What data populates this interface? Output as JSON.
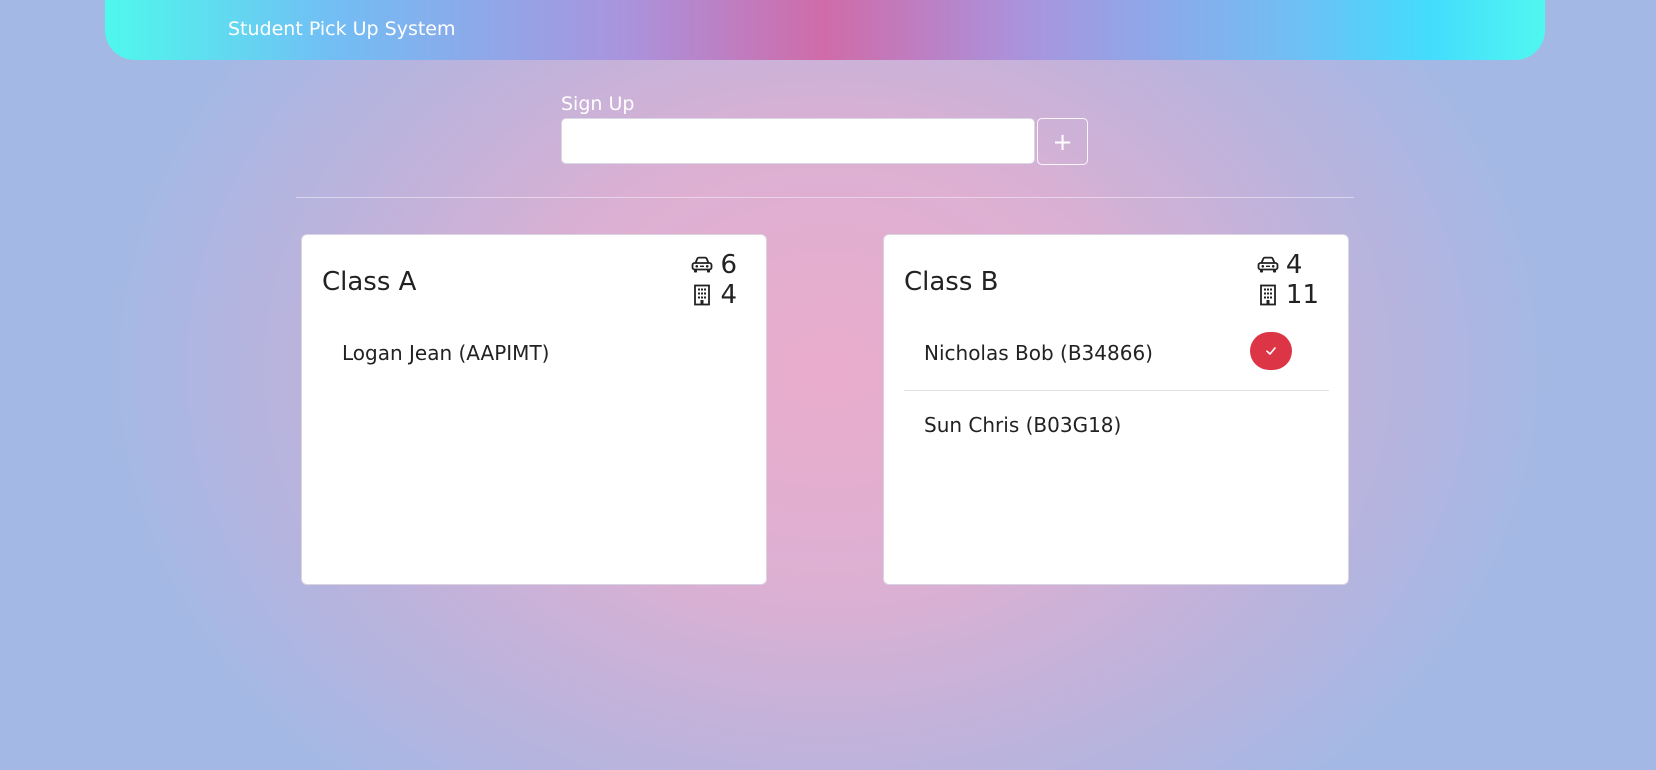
{
  "navbar": {
    "brand": "Student Pick Up System"
  },
  "signup": {
    "label": "Sign Up",
    "input_value": "",
    "add_button_label": "+"
  },
  "classes": [
    {
      "title": "Class A",
      "car_count": "6",
      "building_count": "4",
      "students": [
        {
          "name": "Logan Jean (AAPIMT)"
        }
      ]
    },
    {
      "title": "Class B",
      "car_count": "4",
      "building_count": "11",
      "students": [
        {
          "name": "Nicholas Bob (B34866)",
          "action_icon": "check-icon"
        },
        {
          "name": "Sun Chris (B03G18)"
        }
      ]
    }
  ],
  "icons": {
    "car": "car-front-icon",
    "building": "building-icon",
    "check": "check-icon"
  },
  "colors": {
    "danger": "#dc3545",
    "navbar_gradient_center": "#d06ba8",
    "navbar_gradient_edge": "#4ff8ec"
  }
}
